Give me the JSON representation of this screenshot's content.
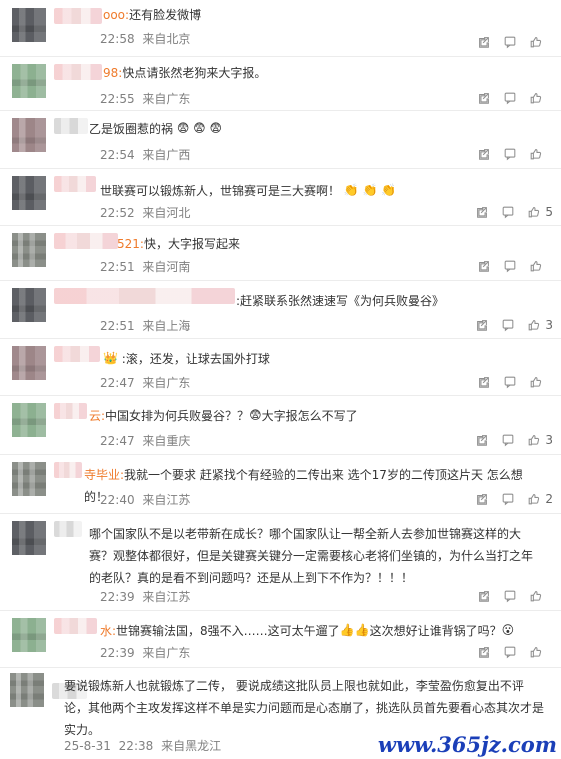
{
  "comments": [
    {
      "prefix": "ooo:",
      "text": "还有脸发微博",
      "time": "22:58",
      "location": "来自北京",
      "likes": ""
    },
    {
      "prefix": "98:",
      "text": "快点请张然老狗来大字报。",
      "time": "22:55",
      "location": "来自广东",
      "likes": ""
    },
    {
      "prefix": "",
      "text": "乙是饭圈惹的祸",
      "time": "22:54",
      "location": "来自广西",
      "likes": ""
    },
    {
      "prefix": "",
      "text": "世联赛可以锻炼新人，世锦赛可是三大赛啊！",
      "time": "22:52",
      "location": "来自河北",
      "likes": "5"
    },
    {
      "prefix": "521:",
      "text": "快，大字报写起来",
      "time": "22:51",
      "location": "来自河南",
      "likes": ""
    },
    {
      "prefix": "",
      "text": ":赶紧联系张然速速写《为何兵败曼谷》",
      "time": "22:51",
      "location": "来自上海",
      "likes": "3"
    },
    {
      "prefix": "",
      "text": ":滚，还发，让球去国外打球",
      "time": "22:47",
      "location": "来自广东",
      "likes": ""
    },
    {
      "prefix": "云:",
      "text": "中国女排为何兵败曼谷？？",
      "text2": "大字报怎么不写了",
      "time": "22:47",
      "location": "来自重庆",
      "likes": "3"
    },
    {
      "prefix": "寺毕业:",
      "text": "我就一个要求 赶紧找个有经验的二传出来 选个17岁的二传顶这片天 怎么想的！",
      "time": "22:40",
      "location": "来自江苏",
      "likes": "2"
    },
    {
      "prefix": "",
      "text": "哪个国家队不是以老带新在成长？哪个国家队让一帮全新人去参加世锦赛这样的大赛？观整体都很好，但是关键赛关键分一定需要核心老将们坐镇的，为什么当打之年的老队？真的是看不到问题吗？还是从上到下不作为？！！！",
      "time": "22:39",
      "location": "来自江苏",
      "likes": ""
    },
    {
      "prefix": "水:",
      "text": "世锦赛输法国，8强不入……这可太午遛了",
      "text2": "这次想好让谁背锅了吗？",
      "time": "22:39",
      "location": "来自广东",
      "likes": ""
    },
    {
      "prefix": "",
      "text": "要说锻炼新人也就锻炼了二传， 要说成绩这批队员上限也就如此，李莹盈伤愈复出不评论，其他两个主攻发挥这样不单是实力问题而是心态崩了，挑选队员首先要看心态其次才是实力。",
      "date": "25-8-31",
      "time": "22:38",
      "location": "来自黑龙江",
      "likes": ""
    }
  ],
  "watermark": "www.365jz.com",
  "icons": {
    "share": "share-icon",
    "comment": "comment-icon",
    "like": "thumbs-up-icon"
  }
}
